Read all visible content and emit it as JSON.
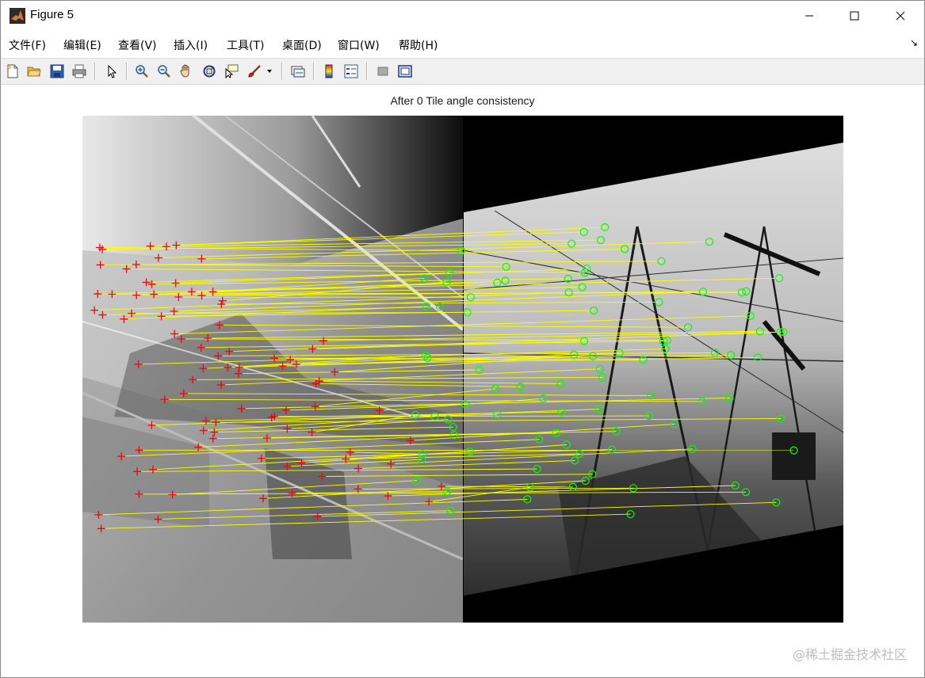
{
  "window": {
    "title": "Figure 5",
    "controls": [
      "minimize",
      "maximize",
      "close"
    ]
  },
  "menu": {
    "items": [
      "文件(F)",
      "编辑(E)",
      "查看(V)",
      "插入(I)",
      "工具(T)",
      "桌面(D)",
      "窗口(W)",
      "帮助(H)"
    ],
    "dock_glyph": "↘"
  },
  "toolbar": {
    "buttons": [
      {
        "name": "new-figure-icon"
      },
      {
        "name": "open-file-icon"
      },
      {
        "name": "save-icon"
      },
      {
        "name": "print-icon"
      },
      {
        "name": "edit-plot-arrow-icon"
      },
      {
        "name": "zoom-in-icon"
      },
      {
        "name": "zoom-out-icon"
      },
      {
        "name": "pan-hand-icon"
      },
      {
        "name": "rotate-3d-icon"
      },
      {
        "name": "data-cursor-icon"
      },
      {
        "name": "brush-icon"
      },
      {
        "name": "link-plot-icon"
      },
      {
        "name": "colorbar-icon"
      },
      {
        "name": "legend-icon"
      },
      {
        "name": "hide-plot-tools-icon"
      },
      {
        "name": "show-plot-tools-icon"
      }
    ]
  },
  "figure": {
    "title": "After 0 Tile angle consistency",
    "match_count": 95,
    "marker_left": "+",
    "marker_right": "o",
    "colors": {
      "left_marker": "#ff0000",
      "right_marker": "#00ff00",
      "match_line": "#ffff00"
    }
  },
  "watermark": "@稀土掘金技术社区"
}
